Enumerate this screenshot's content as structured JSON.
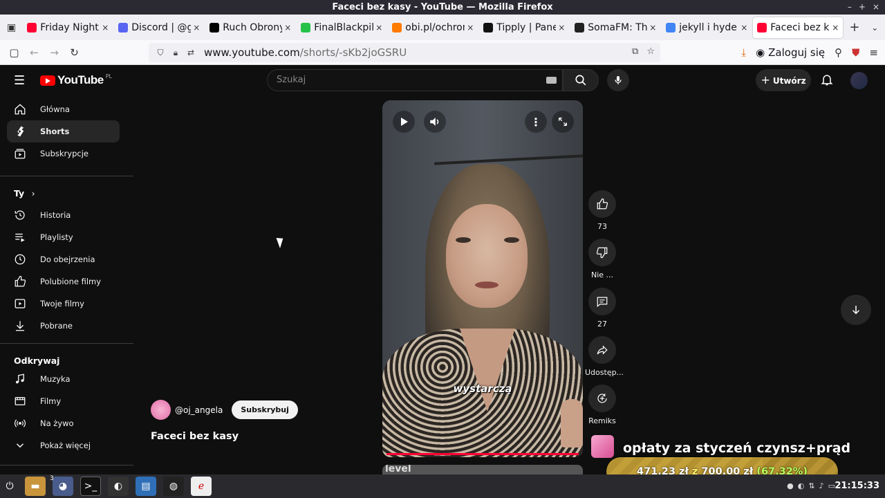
{
  "window": {
    "title": "Faceci bez kasy - YouTube — Mozilla Firefox"
  },
  "tabs": [
    {
      "title": "Friday Night",
      "favicon_color": "#ff0033"
    },
    {
      "title": "Discord | @g",
      "favicon_color": "#5865f2"
    },
    {
      "title": "Ruch Obrony",
      "favicon_color": "#000000"
    },
    {
      "title": "FinalBlackpill",
      "favicon_color": "#25c24a"
    },
    {
      "title": "obi.pl/ochron",
      "favicon_color": "#ff7a00"
    },
    {
      "title": "Tipply | Pane",
      "favicon_color": "#111111"
    },
    {
      "title": "SomaFM: The",
      "favicon_color": "#222222"
    },
    {
      "title": "jekyll i hyde -",
      "favicon_color": "#4285f4"
    },
    {
      "title": "Faceci bez ka",
      "favicon_color": "#ff0033"
    }
  ],
  "toolbar": {
    "url_host": "www.youtube.com",
    "url_path": "/shorts/-sKb2joGSRU",
    "login_label": "Zaloguj się"
  },
  "youtube": {
    "logo_text": "YouTube",
    "country_code": "PL",
    "search_placeholder": "Szukaj",
    "create_label": "Utwórz"
  },
  "sidebar": {
    "main": [
      {
        "label": "Główna",
        "icon": "home-icon"
      },
      {
        "label": "Shorts",
        "icon": "shorts-icon",
        "active": true
      },
      {
        "label": "Subskrypcje",
        "icon": "subscriptions-icon"
      }
    ],
    "you_heading": "Ty",
    "you": [
      {
        "label": "Historia",
        "icon": "history-icon"
      },
      {
        "label": "Playlisty",
        "icon": "playlist-icon"
      },
      {
        "label": "Do obejrzenia",
        "icon": "clock-icon"
      },
      {
        "label": "Polubione filmy",
        "icon": "like-icon"
      },
      {
        "label": "Twoje filmy",
        "icon": "video-icon"
      },
      {
        "label": "Pobrane",
        "icon": "download-icon"
      }
    ],
    "explore_heading": "Odkrywaj",
    "explore": [
      {
        "label": "Muzyka",
        "icon": "music-icon"
      },
      {
        "label": "Filmy",
        "icon": "film-icon"
      },
      {
        "label": "Na żywo",
        "icon": "live-icon"
      },
      {
        "label": "Pokaż więcej",
        "icon": "chevron-down-icon"
      }
    ]
  },
  "short": {
    "caption": "wystarczą",
    "channel": "@oj_angela",
    "subscribe_label": "Subskrybuj",
    "title": "Faceci bez kasy",
    "next_preview_text": "level"
  },
  "actions": {
    "likes": "73",
    "dislike_label": "Nie ...",
    "comments": "27",
    "share_label": "Udostęp...",
    "remix_label": "Remiks"
  },
  "overlay": {
    "headline": "opłaty za styczeń czynsz+prąd",
    "amount": "471,23 zł",
    "separator": "z",
    "goal": "700,00 zł",
    "percent": "(67.32%)",
    "progress_fraction": 0.6732
  },
  "taskbar": {
    "clock": "21:15:33",
    "firefox_badge": "3"
  }
}
